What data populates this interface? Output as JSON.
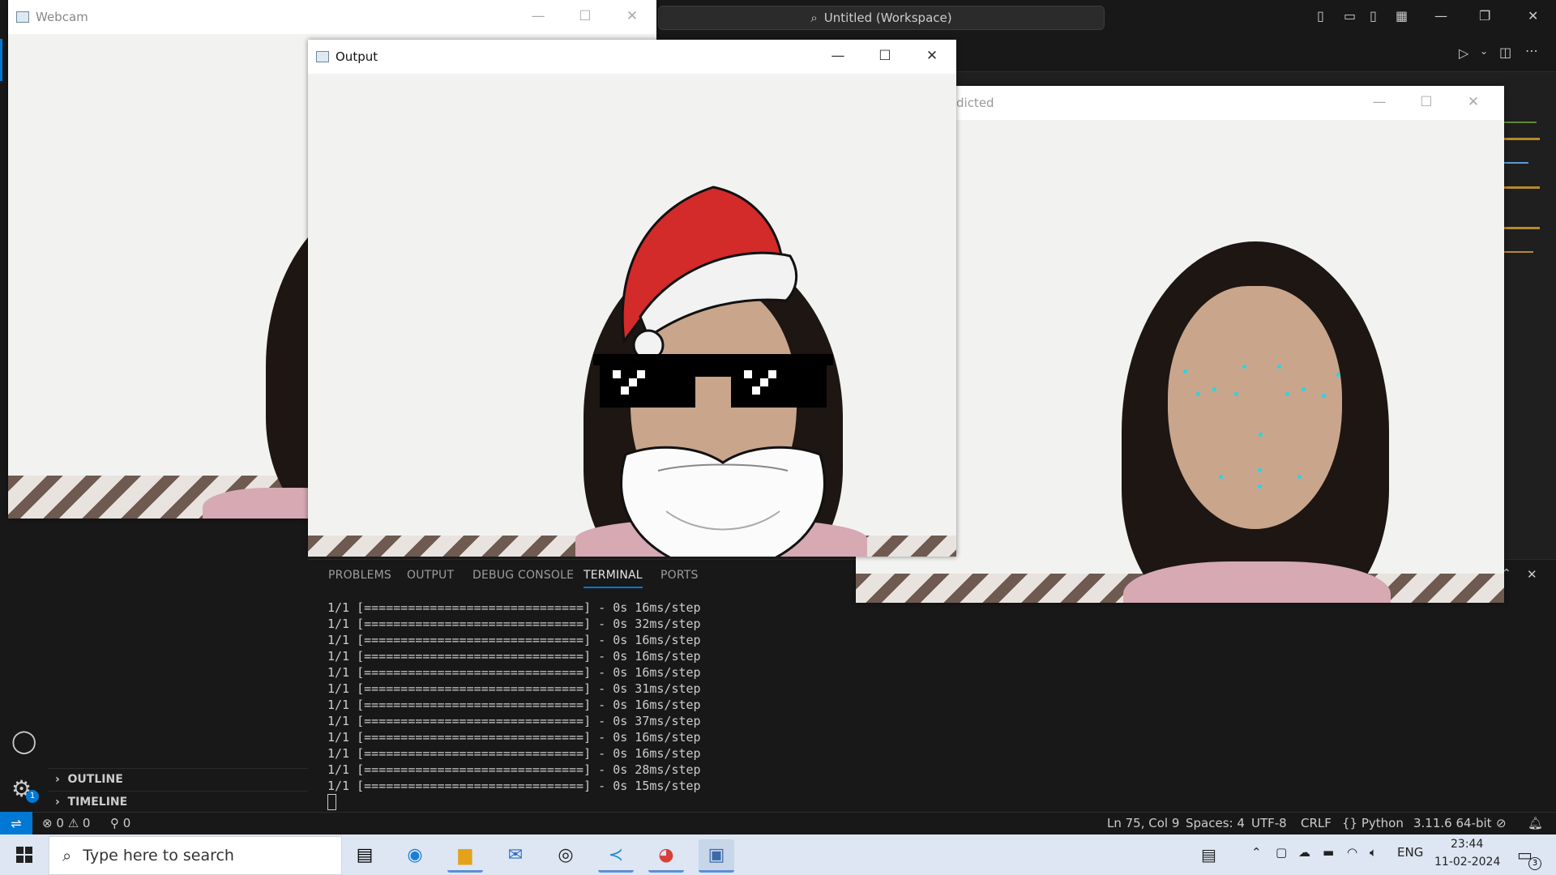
{
  "vscode": {
    "search_text": "Untitled (Workspace)",
    "side_sections": [
      "OUTLINE",
      "TIMELINE"
    ],
    "panel_tabs": [
      "PROBLEMS",
      "OUTPUT",
      "DEBUG CONSOLE",
      "TERMINAL",
      "PORTS"
    ],
    "active_panel_tab": "TERMINAL",
    "terminal_lines": [
      "1/1 [==============================] - 0s 16ms/step",
      "1/1 [==============================] - 0s 32ms/step",
      "1/1 [==============================] - 0s 16ms/step",
      "1/1 [==============================] - 0s 16ms/step",
      "1/1 [==============================] - 0s 16ms/step",
      "1/1 [==============================] - 0s 31ms/step",
      "1/1 [==============================] - 0s 16ms/step",
      "1/1 [==============================] - 0s 37ms/step",
      "1/1 [==============================] - 0s 16ms/step",
      "1/1 [==============================] - 0s 16ms/step",
      "1/1 [==============================] - 0s 28ms/step",
      "1/1 [==============================] - 0s 15ms/step"
    ],
    "status": {
      "errors": "0",
      "warnings": "0",
      "ports": "0",
      "position": "Ln 75, Col 9",
      "spaces": "Spaces: 4",
      "encoding": "UTF-8",
      "eol": "CRLF",
      "language": "Python",
      "interpreter": "3.11.6 64-bit"
    },
    "settings_badge": "1"
  },
  "windows": {
    "webcam_title": "Webcam",
    "output_title": "Output",
    "predicted_title_fragment": "dicted"
  },
  "taskbar": {
    "search_placeholder": "Type here to search",
    "language": "ENG",
    "time": "23:44",
    "date": "11-02-2024",
    "notification_count": "3"
  },
  "colors": {
    "accent": "#0078d4",
    "landmark": "#25d6e8",
    "santa_red": "#d32a2a"
  }
}
